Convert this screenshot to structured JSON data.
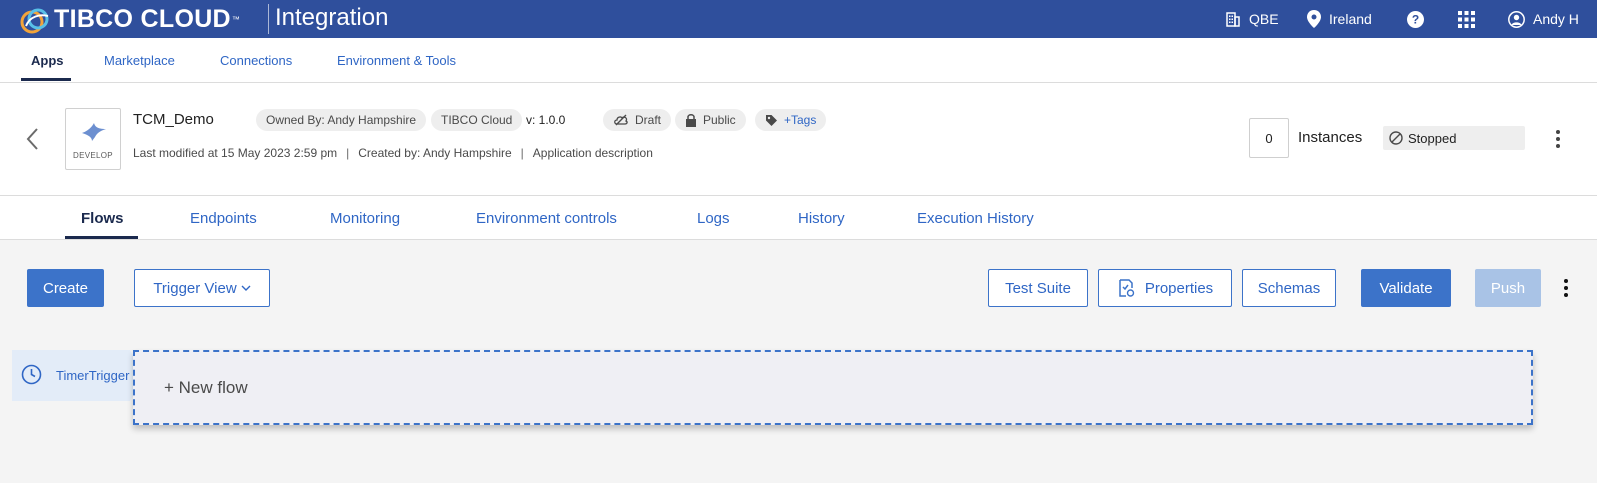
{
  "header": {
    "brand": "TIBCO CLOUD",
    "brand_tm": "™",
    "product": "Integration",
    "org": "QBE",
    "region": "Ireland",
    "user": "Andy H",
    "icons": [
      "building-icon",
      "location-pin-icon",
      "help-icon",
      "app-grid-icon",
      "user-icon"
    ]
  },
  "nav": {
    "items": [
      "Apps",
      "Marketplace",
      "Connections",
      "Environment & Tools"
    ],
    "active": "Apps"
  },
  "app": {
    "name": "TCM_Demo",
    "stage": "DEVELOP",
    "owned_by": "Owned By:  Andy Hampshire",
    "platform": "TIBCO Cloud",
    "version": "v: 1.0.0",
    "state": "Draft",
    "visibility": "Public",
    "tags": "+Tags",
    "last_modified": "Last modified at 15 May 2023 2:59 pm",
    "created_by": "Created by: Andy Hampshire",
    "description": "Application description",
    "separator": "|",
    "instances_count": "0",
    "instances_label": "Instances",
    "status": "Stopped"
  },
  "tabs": {
    "items": [
      "Flows",
      "Endpoints",
      "Monitoring",
      "Environment controls",
      "Logs",
      "History",
      "Execution History"
    ],
    "active": "Flows"
  },
  "toolbar": {
    "create": "Create",
    "trigger_view": "Trigger View",
    "test_suite": "Test Suite",
    "properties": "Properties",
    "schemas": "Schemas",
    "validate": "Validate",
    "push": "Push"
  },
  "flows": {
    "trigger_name": "TimerTrigger",
    "new_flow": "+ New flow"
  },
  "colors": {
    "header_bg": "#2f4f9c",
    "accent": "#3c73c9",
    "link": "#2f66c5",
    "active_nav": "#1b2a4e",
    "disabled": "#a9c3e6"
  }
}
